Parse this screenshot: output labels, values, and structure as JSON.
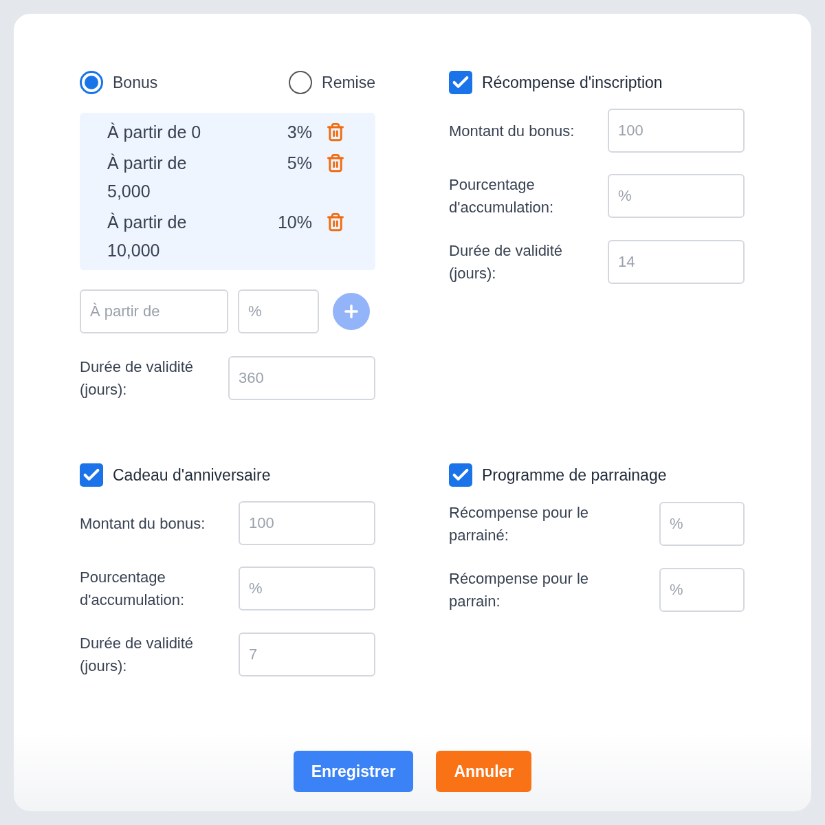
{
  "reward_type": {
    "options": [
      {
        "label": "Bonus",
        "selected": true
      },
      {
        "label": "Remise",
        "selected": false
      }
    ]
  },
  "tiers": [
    {
      "threshold": "À partir de 0",
      "percent": "3%"
    },
    {
      "threshold": "À partir de 5,000",
      "percent": "5%"
    },
    {
      "threshold": "À partir de 10,000",
      "percent": "10%"
    }
  ],
  "new_tier": {
    "threshold": {
      "placeholder": "À partir de"
    },
    "percent": {
      "placeholder": "%"
    },
    "add_button": {
      "disabled": true
    }
  },
  "validity": {
    "label": "Durée de validité (jours):",
    "placeholder": "360"
  },
  "sections": [
    {
      "title": "Récompense d'inscription",
      "checked": true,
      "fields": [
        {
          "label": "Montant du bonus:",
          "placeholder": "100"
        },
        {
          "label": "Pourcentage d'accumulation:",
          "placeholder": "%"
        },
        {
          "label": "Durée de validité (jours):",
          "placeholder": "14"
        }
      ]
    },
    {
      "title": "Cadeau d'anniversaire",
      "checked": true,
      "fields": [
        {
          "label": "Montant du bonus:",
          "placeholder": "100"
        },
        {
          "label": "Pourcentage d'accumulation:",
          "placeholder": "%"
        },
        {
          "label": "Durée de validité (jours):",
          "placeholder": "7"
        }
      ]
    },
    {
      "title": "Programme de parrainage",
      "checked": true,
      "fields": [
        {
          "label": "Récompense pour le parrainé:",
          "placeholder": "%"
        },
        {
          "label": "Récompense pour le parrain:",
          "placeholder": "%"
        }
      ]
    }
  ],
  "buttons": [
    {
      "label": "Enregistrer",
      "kind": "primary"
    },
    {
      "label": "Annuler",
      "kind": "secondary"
    }
  ]
}
